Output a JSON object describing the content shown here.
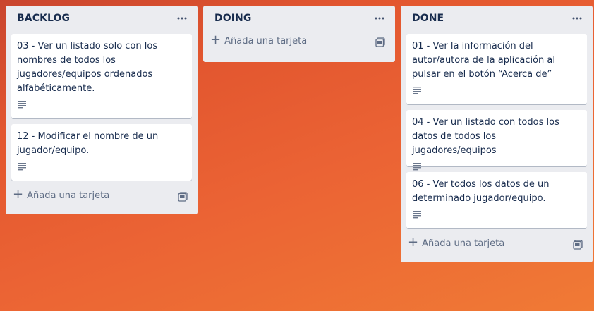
{
  "lists": [
    {
      "title": "BACKLOG",
      "cards": [
        {
          "title": "03 - Ver un listado solo con los nombres de todos los jugadores/equipos ordenados alfabéticamente."
        },
        {
          "title": "12 - Modificar el nombre de un jugador/equipo."
        }
      ],
      "add_label": "Añada una tarjeta"
    },
    {
      "title": "DOING",
      "cards": [],
      "add_label": "Añada una tarjeta"
    },
    {
      "title": "DONE",
      "cards": [
        {
          "title": "01 - Ver la información del autor/autora de la aplicación al pulsar en el botón “Acerca de”"
        },
        {
          "title": "04 - Ver un listado con todos los datos de todos los jugadores/equipos"
        },
        {
          "title": "06 - Ver todos los datos de un determinado jugador/equipo."
        }
      ],
      "add_label": "Añada una tarjeta"
    }
  ],
  "icons": {
    "list_menu": "more-horizontal-icon",
    "description": "description-icon",
    "add": "plus-icon",
    "template": "card-template-icon"
  },
  "colors": {
    "list_bg": "#ebecf0",
    "card_bg": "#ffffff",
    "text": "#172b4d",
    "muted_text": "#5e6c84"
  }
}
